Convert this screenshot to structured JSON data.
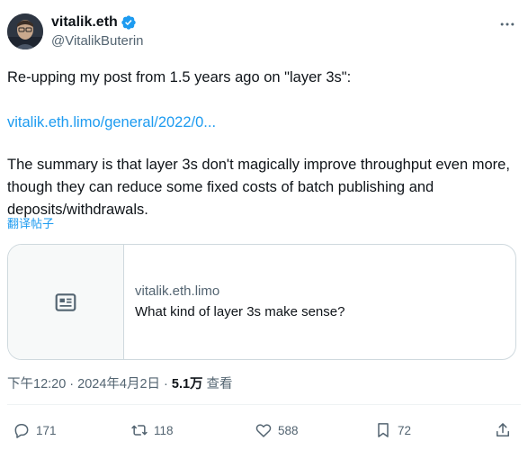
{
  "author": {
    "display_name": "vitalik.eth",
    "handle": "@VitalikButerin",
    "avatar_icon": "avatar-portrait",
    "verified_icon": "verified-badge-icon",
    "verified_color": "#1d9bf0"
  },
  "post": {
    "line1": "Re-upping my post from 1.5 years ago on \"layer 3s\":",
    "link_text": "vitalik.eth.limo/general/2022/0...",
    "line3": "The summary is that layer 3s don't magically improve throughput even more, though they can reduce some fixed costs of batch publishing and deposits/withdrawals.",
    "translate_label": "翻译帖子"
  },
  "card": {
    "icon": "article-icon",
    "domain": "vitalik.eth.limo",
    "title": "What kind of layer 3s make sense?"
  },
  "meta": {
    "time": "下午12:20",
    "separator": "·",
    "date": "2024年4月2日",
    "views_count": "5.1万",
    "views_label": "查看"
  },
  "actions": {
    "reply_count": "171",
    "retweet_count": "118",
    "like_count": "588",
    "bookmark_count": "72"
  },
  "colors": {
    "link": "#1d9bf0",
    "secondary_text": "#536471",
    "border": "#cfd9de"
  }
}
